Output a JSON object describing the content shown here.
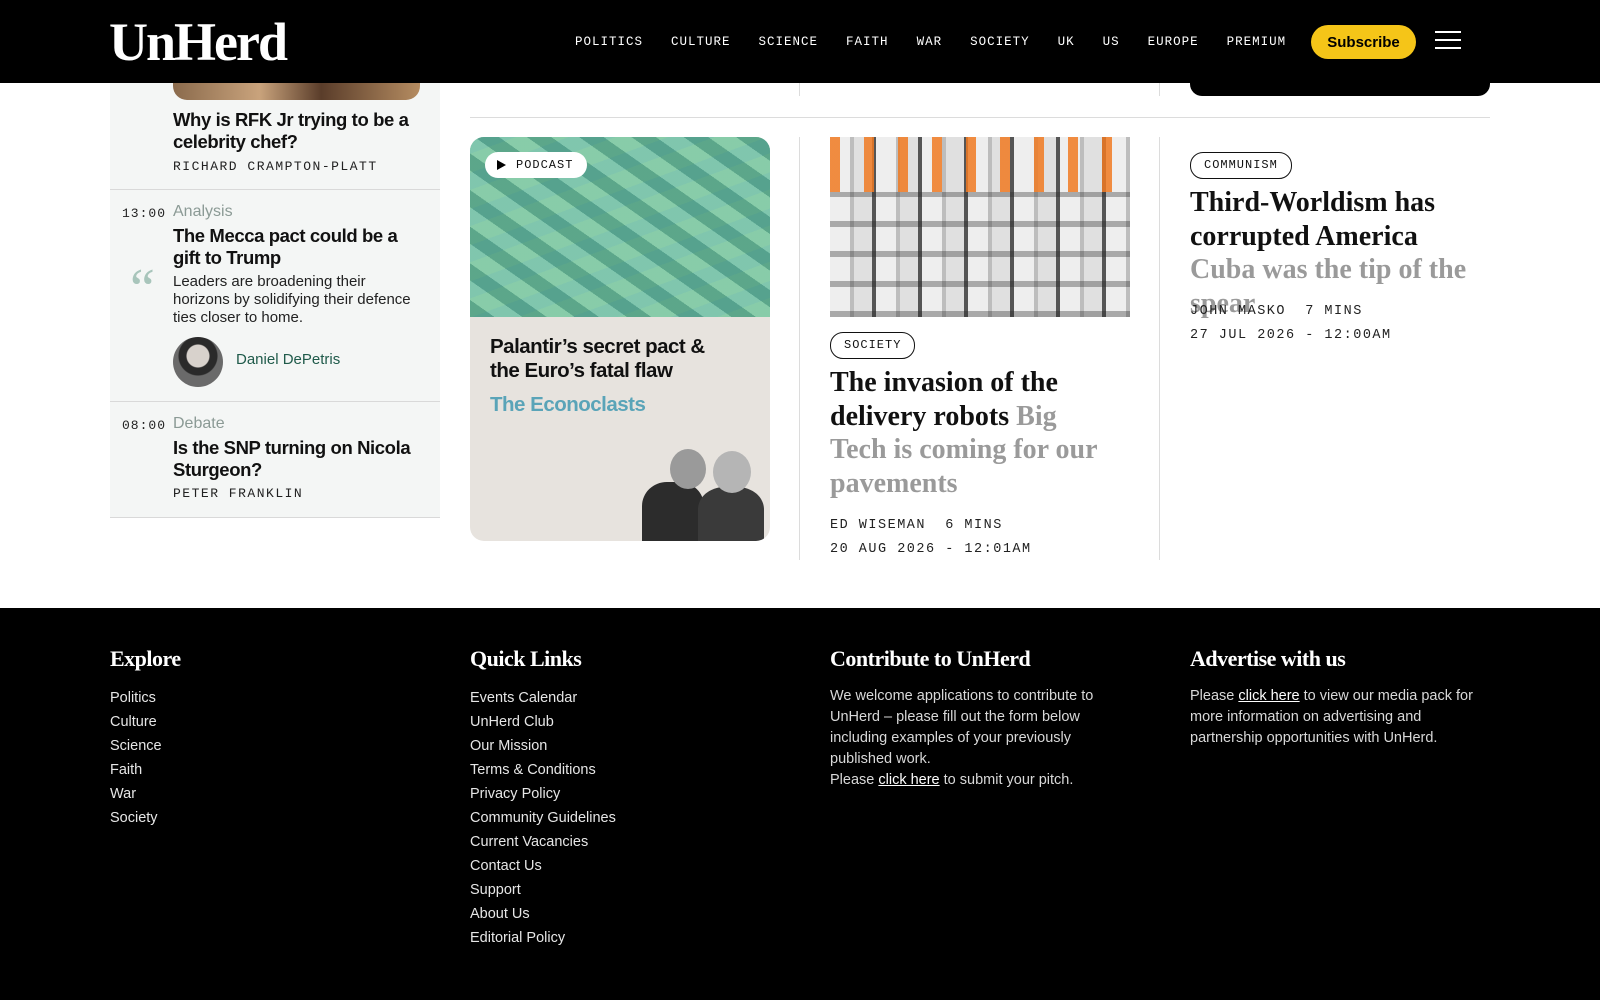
{
  "header": {
    "logo": "UnHerd",
    "nav": [
      "POLITICS",
      "CULTURE",
      "SCIENCE",
      "FAITH",
      "WAR",
      "SOCIETY",
      "UK",
      "US",
      "EUROPE",
      "PREMIUM"
    ],
    "subscribe_label": "Subscribe",
    "menu_icon": "hamburger-icon"
  },
  "sidebar": {
    "items": [
      {
        "title": "Why is RFK Jr trying to be a celebrity chef?",
        "author": "RICHARD CRAMPTON-PLATT"
      },
      {
        "time": "13:00",
        "type": "Analysis",
        "title": "The Mecca pact could be a gift to Trump",
        "quote": "Leaders are broadening their horizons by solidifying their defence ties closer to home.",
        "author": "Daniel DePetris"
      },
      {
        "time": "08:00",
        "type": "Debate",
        "title": "Is the SNP turning on Nicola Sturgeon?",
        "author": "PETER FRANKLIN"
      }
    ]
  },
  "podcast": {
    "badge": "PODCAST",
    "title": "Palantir’s secret pact & the Euro’s fatal flaw",
    "series": "The Econoclasts"
  },
  "article_society": {
    "tag": "SOCIETY",
    "title": "The invasion of the delivery robots",
    "subtitle": "Big Tech is coming for our pavements",
    "author": "ED WISEMAN",
    "read_time": "6 MINS",
    "date": "20 AUG 2026 - 12:01AM"
  },
  "article_communism": {
    "tag": "COMMUNISM",
    "title": "Third-Worldism has corrupted America",
    "subtitle": "Cuba was the tip of the spear",
    "author": "JOHN MASKO",
    "read_time": "7 MINS",
    "date": "27 JUL 2026 - 12:00AM"
  },
  "footer": {
    "explore": {
      "heading": "Explore",
      "links": [
        "Politics",
        "Culture",
        "Science",
        "Faith",
        "War",
        "Society"
      ]
    },
    "quick_links": {
      "heading": "Quick Links",
      "links": [
        "Events Calendar",
        "UnHerd Club",
        "Our Mission",
        "Terms & Conditions",
        "Privacy Policy",
        "Community Guidelines",
        "Current Vacancies",
        "Contact Us",
        "Support",
        "About Us",
        "Editorial Policy"
      ]
    },
    "contribute": {
      "heading": "Contribute to UnHerd",
      "text": "We welcome applications to contribute to UnHerd – please fill out the form below including examples of your previously published work.",
      "pre_link": "Please ",
      "link": "click here",
      "post_link": " to submit your pitch."
    },
    "advertise": {
      "heading": "Advertise with us",
      "pre_link": "Please ",
      "link": "click here",
      "post_link": " to view our media pack for more information on advertising and partnership opportunities with UnHerd."
    }
  }
}
